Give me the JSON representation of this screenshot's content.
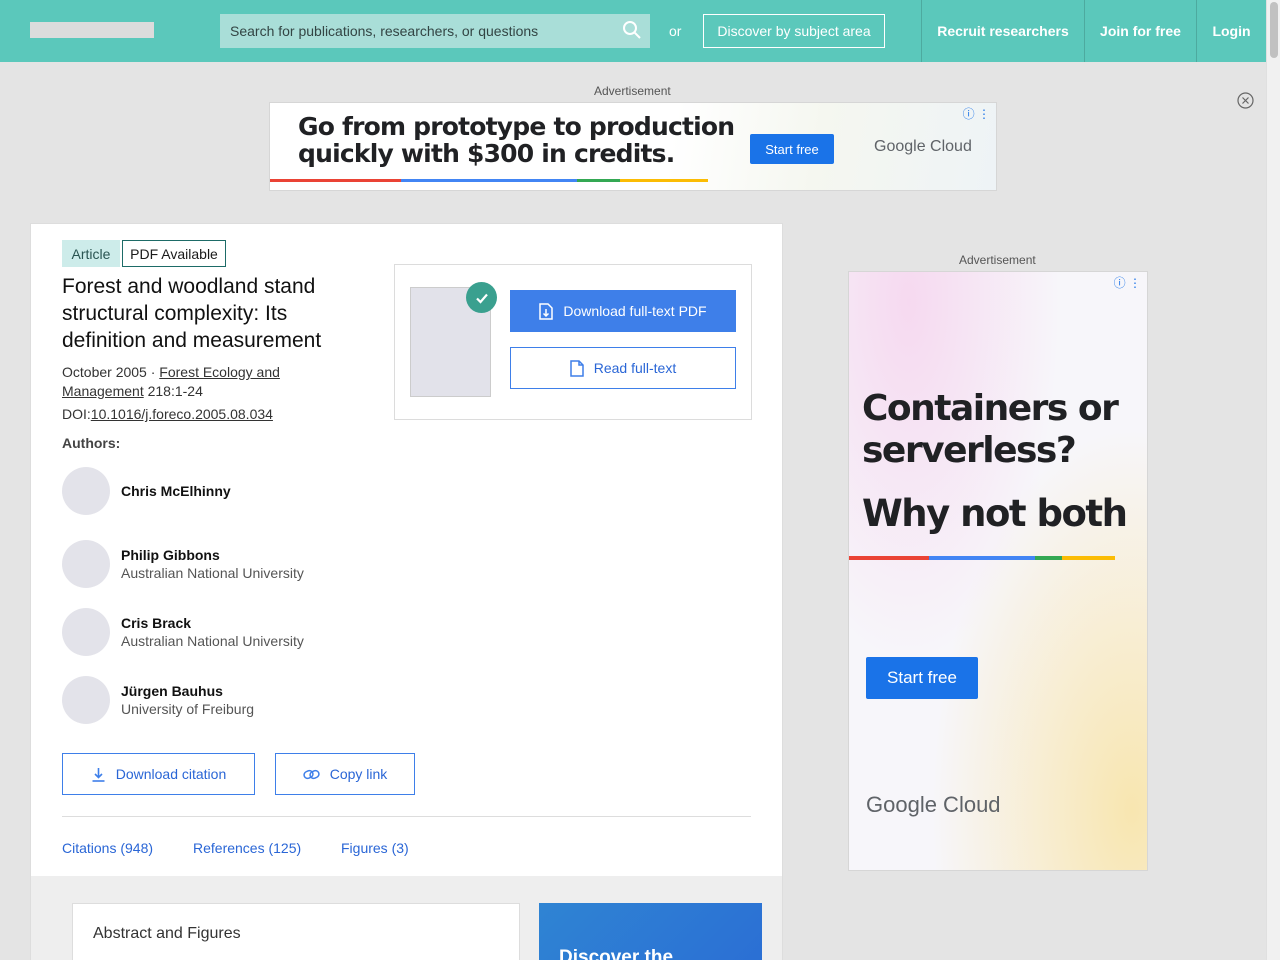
{
  "header": {
    "search_placeholder": "Search for publications, researchers, or questions",
    "or_text": "or",
    "discover_label": "Discover by subject area",
    "nav": [
      "Recruit researchers",
      "Join for free",
      "Login"
    ]
  },
  "ads": {
    "label": "Advertisement",
    "banner": {
      "headline": "Go from prototype to production quickly with $300 in credits.",
      "cta": "Start free",
      "brand": "Google Cloud"
    },
    "side": {
      "headline": "Containers or serverless?",
      "headline2": "Why not both",
      "cta": "Start free",
      "brand": "Google Cloud"
    },
    "adchoice": "ⓘ ⋮"
  },
  "article": {
    "type_badge": "Article",
    "pdf_badge": "PDF Available",
    "title": "Forest and woodland stand structural complexity: Its definition and measurement",
    "date": "October 2005 · ",
    "journal": "Forest Ecology and Management",
    "pages": " 218:1-24",
    "doi_label": "DOI:",
    "doi": "10.1016/j.foreco.2005.08.034",
    "authors_label": "Authors:",
    "authors": [
      {
        "name": "Chris McElhinny",
        "affiliation": ""
      },
      {
        "name": "Philip Gibbons",
        "affiliation": "Australian National University"
      },
      {
        "name": "Cris Brack",
        "affiliation": "Australian National University"
      },
      {
        "name": "Jürgen Bauhus",
        "affiliation": "University of Freiburg"
      }
    ],
    "download_pdf": "Download full-text PDF",
    "read_fulltext": "Read full-text",
    "download_citation": "Download citation",
    "copy_link": "Copy link",
    "tabs": [
      "Citations (948)",
      "References (125)",
      "Figures (3)"
    ],
    "abstract_heading": "Abstract and Figures",
    "promo_text": "Discover the"
  },
  "colors": {
    "header": "#5bc8bb",
    "primary_button": "#3e7fe9",
    "badge_teal": "#cdecea",
    "google_blue": "#1a73e8"
  }
}
